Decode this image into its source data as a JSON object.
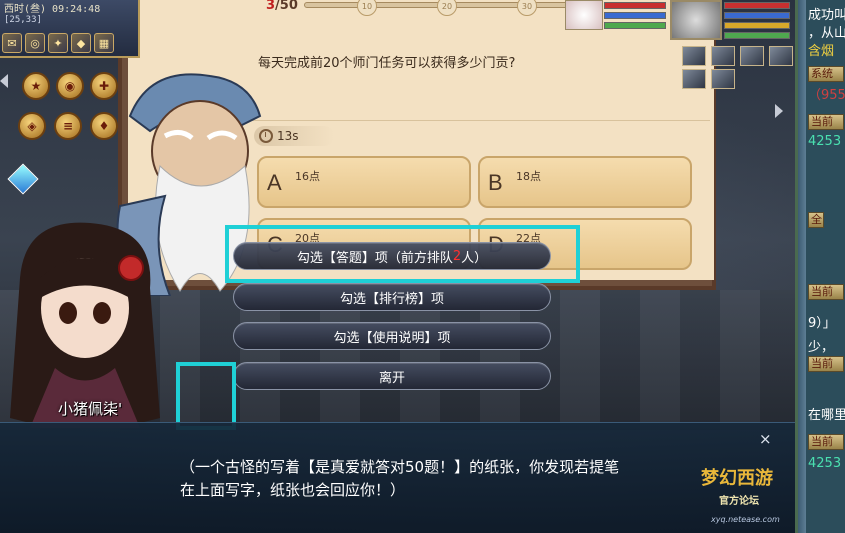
{
  "status": {
    "time": "西时(叁) 09:24:48",
    "coords": "[25,33]"
  },
  "quiz": {
    "progress_current": "3",
    "progress_total": "/50",
    "milestones": [
      "10",
      "20",
      "30"
    ],
    "question": "每天完成前20个师门任务可以获得多少门贡?",
    "timer": "13s",
    "options": [
      {
        "letter": "A",
        "text": "16点"
      },
      {
        "letter": "B",
        "text": "18点"
      },
      {
        "letter": "C",
        "text": "20点"
      },
      {
        "letter": "D",
        "text": "22点"
      }
    ]
  },
  "npc": {
    "name": "小猪佩柒'"
  },
  "menu": {
    "answer_prefix": "勾选【答题】项（前方排队",
    "answer_count": "2",
    "answer_suffix": "人）",
    "rank": "勾选【排行榜】项",
    "help": "勾选【使用说明】项",
    "leave": "离开"
  },
  "dialog": {
    "text": "（一个古怪的写着【是真爱就答对50题！】的纸张，你发现若提笔在上面写字，纸张也会回应你！）",
    "close": "×"
  },
  "chat": {
    "line1": "成功叫",
    "line2": "，从山",
    "line3": "含烟",
    "tag_system": "系统",
    "line4": "（955",
    "tag_current1": "当前",
    "line5": "4253",
    "tag_all": "全",
    "tag_current2": "当前",
    "line6": "9）」",
    "line7": "少，",
    "tag_current3": "当前",
    "line8": "在哪里",
    "tag_current4": "当前",
    "line9": "4253"
  },
  "logo": {
    "title": "梦幻西游",
    "sub": "官方论坛",
    "url": "xyq.netease.com"
  },
  "colors": {
    "highlight": "#1fd0d6",
    "count_red": "#ff3030"
  }
}
